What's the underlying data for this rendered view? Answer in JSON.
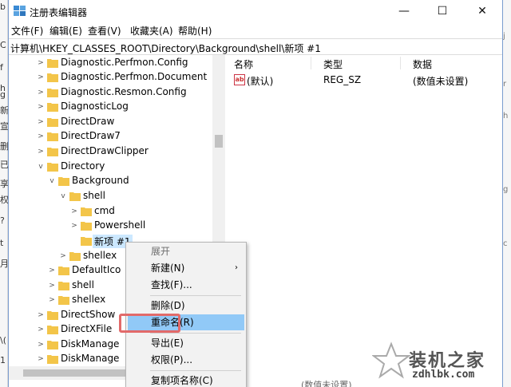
{
  "window": {
    "title": "注册表编辑器",
    "minimize_glyph": "—",
    "maximize_glyph": "☐",
    "close_glyph": "✕"
  },
  "menu": [
    "文件(F)",
    "编辑(E)",
    "查看(V)",
    "收藏夹(A)",
    "帮助(H)"
  ],
  "address": "计算机\\HKEY_CLASSES_ROOT\\Directory\\Background\\shell\\新项 #1",
  "tree": [
    {
      "label": "Diagnostic.Perfmon.Config",
      "expanded": false
    },
    {
      "label": "Diagnostic.Perfmon.Document",
      "expanded": false
    },
    {
      "label": "Diagnostic.Resmon.Config",
      "expanded": false
    },
    {
      "label": "DiagnosticLog",
      "expanded": false
    },
    {
      "label": "DirectDraw",
      "expanded": false
    },
    {
      "label": "DirectDraw7",
      "expanded": false
    },
    {
      "label": "DirectDrawClipper",
      "expanded": false
    },
    {
      "label": "Directory",
      "expanded": true
    },
    {
      "label": "Background",
      "expanded": true
    },
    {
      "label": "shell",
      "expanded": true
    },
    {
      "label": "cmd",
      "expanded": false
    },
    {
      "label": "Powershell",
      "expanded": false
    },
    {
      "label": "新项 #1",
      "expanded": false,
      "selected": true
    },
    {
      "label": "shellex",
      "expanded": false
    },
    {
      "label": "DefaultIco",
      "expanded": false
    },
    {
      "label": "shell",
      "expanded": false
    },
    {
      "label": "shellex",
      "expanded": false
    },
    {
      "label": "DirectShow",
      "expanded": false
    },
    {
      "label": "DirectXFile",
      "expanded": false
    },
    {
      "label": "DiskManage",
      "expanded": false
    },
    {
      "label": "DiskManage",
      "expanded": false
    }
  ],
  "columns": {
    "name": "名称",
    "type": "类型",
    "data": "数据"
  },
  "values": [
    {
      "icon": "ab",
      "name": "(默认)",
      "type": "REG_SZ",
      "data": "(数值未设置)"
    }
  ],
  "context_menu": {
    "expand": "展开",
    "new": "新建(N)",
    "find": "查找(F)...",
    "delete": "删除(D)",
    "rename": "重命名(R)",
    "export": "导出(E)",
    "permissions": "权限(P)...",
    "copy_key_name": "复制项名称(C)",
    "submenu_arrow": "›"
  },
  "background_fragments": {
    "left": [
      "b",
      "C",
      "f",
      "h",
      "g",
      "新",
      "宣",
      "删",
      "已",
      "享",
      "权",
      "?",
      "t",
      "月",
      "\\(",
      "1"
    ],
    "right": [
      "j",
      "r",
      "h",
      "g",
      "c"
    ],
    "status": "(数值未设置)"
  },
  "watermark": {
    "name": "装机之家",
    "url": "zdhlbk.com"
  },
  "colors": {
    "selection": "#cce8ff",
    "menu_hover": "#91c9f7",
    "highlight": "#e26a6a",
    "folder": "#f3c549"
  }
}
